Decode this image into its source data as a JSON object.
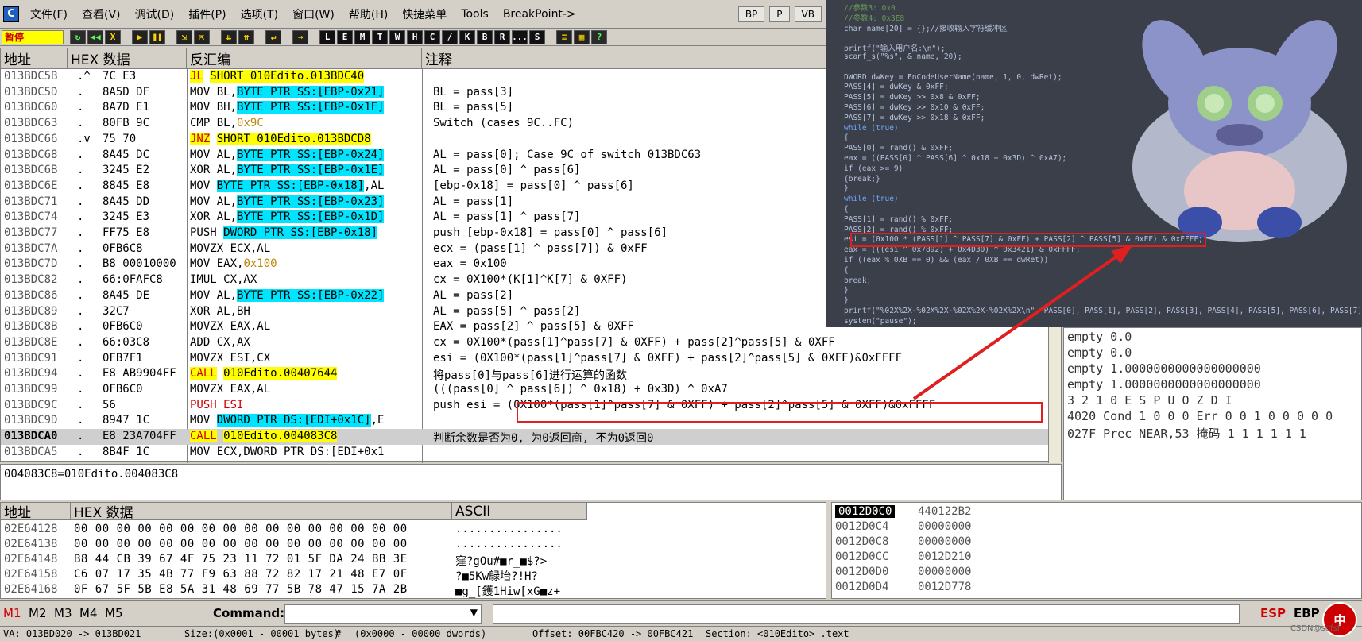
{
  "menu": {
    "items": [
      "文件(F)",
      "查看(V)",
      "调试(D)",
      "插件(P)",
      "选项(T)",
      "窗口(W)",
      "帮助(H)",
      "快捷菜单",
      "Tools",
      "BreakPoint->"
    ],
    "buttons": [
      "BP",
      "P",
      "VB"
    ],
    "app_icon": "C"
  },
  "toolbar": {
    "status": "暂停",
    "buttons_a": [
      "↻",
      "◀◀",
      "X",
      "▶",
      "❚❚",
      "⇲",
      "⇱",
      "⇊",
      "⇈",
      "↵",
      "→"
    ],
    "buttons_b": [
      "L",
      "E",
      "M",
      "T",
      "W",
      "H",
      "C",
      "/",
      "K",
      "B",
      "R",
      "...",
      "S"
    ],
    "buttons_c": [
      "≡",
      "▦",
      "?"
    ]
  },
  "cpu": {
    "headers": {
      "addr": "地址",
      "hex": "HEX 数据",
      "disasm": "反汇编",
      "comment": "注释"
    },
    "rows": [
      {
        "addr": "013BDC5B",
        "mark": ".^",
        "hex": "7C E3",
        "dis_pre": "",
        "dis_hl": "JL",
        "dis_hl2": "SHORT 010Edito.013BDC40",
        "dis_post": "",
        "cmt": ""
      },
      {
        "addr": "013BDC5D",
        "mark": ".",
        "hex": "8A5D DF",
        "dis_pre": "MOV BL,",
        "dis_hl": "BYTE PTR SS:[EBP-0x21]",
        "dis_post": "",
        "cmt": "BL = pass[3]"
      },
      {
        "addr": "013BDC60",
        "mark": ".",
        "hex": "8A7D E1",
        "dis_pre": "MOV BH,",
        "dis_hl": "BYTE PTR SS:[EBP-0x1F]",
        "dis_post": "",
        "cmt": "BL = pass[5]"
      },
      {
        "addr": "013BDC63",
        "mark": ".",
        "hex": "80FB 9C",
        "dis_pre": "CMP BL,",
        "dis_hl": "0x9C",
        "dis_post": "",
        "cmt": "Switch (cases 9C..FC)"
      },
      {
        "addr": "013BDC66",
        "mark": ".v",
        "hex": "75 70",
        "dis_pre": "",
        "dis_hl": "JNZ",
        "dis_hl2": "SHORT 010Edito.013BDCD8",
        "dis_post": "",
        "cmt": ""
      },
      {
        "addr": "013BDC68",
        "mark": ".",
        "hex": "8A45 DC",
        "dis_pre": "MOV AL,",
        "dis_hl": "BYTE PTR SS:[EBP-0x24]",
        "dis_post": "",
        "cmt": "AL = pass[0]; Case 9C of switch 013BDC63"
      },
      {
        "addr": "013BDC6B",
        "mark": ".",
        "hex": "3245 E2",
        "dis_pre": "XOR AL,",
        "dis_hl": "BYTE PTR SS:[EBP-0x1E]",
        "dis_post": "",
        "cmt": "AL = pass[0] ^ pass[6]"
      },
      {
        "addr": "013BDC6E",
        "mark": ".",
        "hex": "8845 E8",
        "dis_pre": "MOV ",
        "dis_hl": "BYTE PTR SS:[EBP-0x18]",
        "dis_post": ",AL",
        "cmt": "[ebp-0x18] = pass[0] ^ pass[6]"
      },
      {
        "addr": "013BDC71",
        "mark": ".",
        "hex": "8A45 DD",
        "dis_pre": "MOV AL,",
        "dis_hl": "BYTE PTR SS:[EBP-0x23]",
        "dis_post": "",
        "cmt": "AL = pass[1]"
      },
      {
        "addr": "013BDC74",
        "mark": ".",
        "hex": "3245 E3",
        "dis_pre": "XOR AL,",
        "dis_hl": "BYTE PTR SS:[EBP-0x1D]",
        "dis_post": "",
        "cmt": "AL = pass[1] ^ pass[7]"
      },
      {
        "addr": "013BDC77",
        "mark": ".",
        "hex": "FF75 E8",
        "dis_pre": "PUSH ",
        "dis_hl": "DWORD PTR SS:[EBP-0x18]",
        "dis_post": "",
        "cmt": "push [ebp-0x18] = pass[0] ^ pass[6]"
      },
      {
        "addr": "013BDC7A",
        "mark": ".",
        "hex": "0FB6C8",
        "dis_pre": "MOVZX ECX,AL",
        "dis_hl": "",
        "dis_post": "",
        "cmt": "ecx = (pass[1] ^ pass[7]) & 0xFF"
      },
      {
        "addr": "013BDC7D",
        "mark": ".",
        "hex": "B8 00010000",
        "dis_pre": "MOV EAX,",
        "dis_hl": "0x100",
        "dis_post": "",
        "cmt": "eax = 0x100"
      },
      {
        "addr": "013BDC82",
        "mark": ".",
        "hex": "66:0FAFC8",
        "dis_pre": "IMUL CX,AX",
        "dis_hl": "",
        "dis_post": "",
        "cmt": "cx = 0X100*(K[1]^K[7] & 0XFF)"
      },
      {
        "addr": "013BDC86",
        "mark": ".",
        "hex": "8A45 DE",
        "dis_pre": "MOV AL,",
        "dis_hl": "BYTE PTR SS:[EBP-0x22]",
        "dis_post": "",
        "cmt": "AL = pass[2]"
      },
      {
        "addr": "013BDC89",
        "mark": ".",
        "hex": "32C7",
        "dis_pre": "XOR AL,BH",
        "dis_hl": "",
        "dis_post": "",
        "cmt": "AL = pass[5] ^ pass[2]"
      },
      {
        "addr": "013BDC8B",
        "mark": ".",
        "hex": "0FB6C0",
        "dis_pre": "MOVZX EAX,AL",
        "dis_hl": "",
        "dis_post": "",
        "cmt": "EAX = pass[2] ^ pass[5] & 0XFF"
      },
      {
        "addr": "013BDC8E",
        "mark": ".",
        "hex": "66:03C8",
        "dis_pre": "ADD CX,AX",
        "dis_hl": "",
        "dis_post": "",
        "cmt": "cx = 0X100*(pass[1]^pass[7] & 0XFF) + pass[2]^pass[5] & 0XFF"
      },
      {
        "addr": "013BDC91",
        "mark": ".",
        "hex": "0FB7F1",
        "dis_pre": "MOVZX ESI,CX",
        "dis_hl": "",
        "dis_post": "",
        "cmt": "esi = (0X100*(pass[1]^pass[7] & 0XFF) + pass[2]^pass[5] & 0XFF)&0xFFFF"
      },
      {
        "addr": "013BDC94",
        "mark": ".",
        "hex": "E8 AB9904FF",
        "dis_pre": "",
        "dis_hl": "CALL",
        "dis_hl2": "010Edito.00407644",
        "dis_post": "",
        "cmt": "将pass[0]与pass[6]进行运算的函数"
      },
      {
        "addr": "013BDC99",
        "mark": ".",
        "hex": "0FB6C0",
        "dis_pre": "MOVZX EAX,AL",
        "dis_hl": "",
        "dis_post": "",
        "cmt": "(((pass[0] ^ pass[6]) ^ 0x18) + 0x3D) ^ 0xA7"
      },
      {
        "addr": "013BDC9C",
        "mark": ".",
        "hex": "56",
        "dis_pre": "",
        "dis_hl": "PUSH ESI",
        "dis_post": "",
        "cmt": "push esi = (0X100*(pass[1]^pass[7] & 0XFF) + pass[2]^pass[5] & 0XFF)&0xFFFF"
      },
      {
        "addr": "013BDC9D",
        "mark": ".",
        "hex": "8947 1C",
        "dis_pre": "MOV ",
        "dis_hl": "DWORD PTR DS:[EDI+0x1C]",
        "dis_post": ",E",
        "cmt": ""
      },
      {
        "addr": "013BDCA0",
        "mark": ".",
        "hex": "E8 23A704FF",
        "dis_pre": "",
        "dis_hl": "CALL",
        "dis_hl2": "010Edito.004083C8",
        "dis_post": "",
        "cmt": "判断余数是否为0, 为0返回商, 不为0返回0"
      },
      {
        "addr": "013BDCA5",
        "mark": ".",
        "hex": "8B4F 1C",
        "dis_pre": "MOV ECX,DWORD PTR DS:[EDI+0x1",
        "dis_hl": "",
        "dis_post": "",
        "cmt": ""
      }
    ],
    "selected_index": 23,
    "info_line": "004083C8=010Edito.004083C8"
  },
  "registers": {
    "lines": [
      "empty 0.0",
      "empty 0.0",
      "empty 1.0000000000000000000",
      "empty 1.0000000000000000000",
      "        3 2 1 0      E S P U O Z D I",
      "4020  Cond 1 0 0 0  Err 0 0 1 0 0 0 0 0",
      "027F  Prec NEAR,53  掩码    1 1 1 1 1 1"
    ]
  },
  "dump": {
    "headers": {
      "addr": "地址",
      "hex": "HEX 数据",
      "ascii": "ASCII"
    },
    "rows": [
      {
        "addr": "02E64128",
        "hex": "00 00 00 00 00 00 00 00 00 00 00 00 00 00 00 00",
        "ascii": "................"
      },
      {
        "addr": "02E64138",
        "hex": "00 00 00 00 00 00 00 00 00 00 00 00 00 00 00 00",
        "ascii": "................"
      },
      {
        "addr": "02E64148",
        "hex": "B8 44 CB 39 67 4F 75 23 11 72 01 5F DA 24 BB 3E",
        "ascii": "窪?gOu#■r_■$?>"
      },
      {
        "addr": "02E64158",
        "hex": "C6 07 17 35 4B 77 F9 63 88 72 82 17 21 48 E7 0F",
        "ascii": "?■5Kw鵦坮?!H?"
      },
      {
        "addr": "02E64168",
        "hex": "0F 67 5F 5B E8 5A 31 48 69 77 5B 78 47 15 7A 2B",
        "ascii": "■g_[鑊1Hiw[xG■z+"
      }
    ]
  },
  "stack": {
    "rows": [
      {
        "addr": "0012D0C0",
        "val": "440122B2"
      },
      {
        "addr": "0012D0C4",
        "val": "00000000"
      },
      {
        "addr": "0012D0C8",
        "val": "00000000"
      },
      {
        "addr": "0012D0CC",
        "val": "0012D210"
      },
      {
        "addr": "0012D0D0",
        "val": "00000000"
      },
      {
        "addr": "0012D0D4",
        "val": "0012D778"
      }
    ]
  },
  "cmdbar": {
    "tabs": [
      "M1",
      "M2",
      "M3",
      "M4",
      "M5"
    ],
    "label": "Command:",
    "esp": "ESP",
    "ebp": "EBP"
  },
  "status": {
    "va": "VA: 013BD020 -> 013BD021",
    "size": "Size:(0x0001 - 00001 bytes)",
    "hash": "#",
    "dwords": "(0x0000 - 00000 dwords)",
    "offset": "Offset: 00FBC420 -> 00FBC421",
    "section": "Section: <010Edito> .text"
  },
  "overlay": {
    "lines": [
      {
        "t": "//参数3: 0x0",
        "c": "cm"
      },
      {
        "t": "//参数4: 0x3E8",
        "c": "cm"
      },
      {
        "t": "char name[20] = {};//接收输入字符缓冲区",
        "c": ""
      },
      {
        "t": "",
        "c": ""
      },
      {
        "t": "printf(\"输入用户名:\\n\");",
        "c": ""
      },
      {
        "t": "scanf_s(\"%s\", & name, 20);",
        "c": ""
      },
      {
        "t": "",
        "c": ""
      },
      {
        "t": "DWORD dwKey = EnCodeUserName(name, 1, 0, dwRet);",
        "c": ""
      },
      {
        "t": "PASS[4] = dwKey & 0xFF;",
        "c": ""
      },
      {
        "t": "PASS[5] = dwKey >> 0x8 & 0xFF;",
        "c": ""
      },
      {
        "t": "PASS[6] = dwKey >> 0x10 & 0xFF;",
        "c": ""
      },
      {
        "t": "PASS[7] = dwKey >> 0x18 & 0xFF;",
        "c": ""
      },
      {
        "t": "while (true)",
        "c": "kw"
      },
      {
        "t": "{",
        "c": ""
      },
      {
        "t": "    PASS[0] = rand() & 0xFF;",
        "c": ""
      },
      {
        "t": "    eax = ((PASS[0] ^ PASS[6] ^ 0x18 + 0x3D) ^ 0xA7);",
        "c": ""
      },
      {
        "t": "    if (eax >= 9)",
        "c": ""
      },
      {
        "t": "    {break;}",
        "c": ""
      },
      {
        "t": "}",
        "c": ""
      },
      {
        "t": "while (true)",
        "c": "kw"
      },
      {
        "t": "{",
        "c": ""
      },
      {
        "t": "    PASS[1] = rand() % 0xFF;",
        "c": ""
      },
      {
        "t": "    PASS[2] = rand() % 0xFF;",
        "c": ""
      },
      {
        "t": "    esi = (0x100 * (PASS[1] ^ PASS[7] & 0xFF) + PASS[2] ^ PASS[5] & 0xFF) & 0xFFFF;",
        "c": ""
      },
      {
        "t": "    eax = (((esi ^ 0x7892) + 0x4D30) ^ 0x3421) & 0xFFFF;",
        "c": ""
      },
      {
        "t": "    if ((eax % 0XB == 0) && (eax / 0XB == dwRet))",
        "c": ""
      },
      {
        "t": "    {",
        "c": ""
      },
      {
        "t": "        break;",
        "c": ""
      },
      {
        "t": "    }",
        "c": ""
      },
      {
        "t": "}",
        "c": ""
      },
      {
        "t": "printf(\"%02X%2X-%02X%2X-%02X%2X-%02X%2X\\n\", PASS[0], PASS[1], PASS[2], PASS[3], PASS[4], PASS[5], PASS[6], PASS[7]);",
        "c": ""
      },
      {
        "t": "system(\"pause\");",
        "c": ""
      }
    ]
  },
  "ime": "中",
  "watermark": "CSDN@sdfsf",
  "colors": {
    "accent_red": "#e02020",
    "highlight_cyan": "#00e5ff",
    "highlight_yellow": "#ffff00",
    "overlay_bg": "#3b3f4a"
  }
}
